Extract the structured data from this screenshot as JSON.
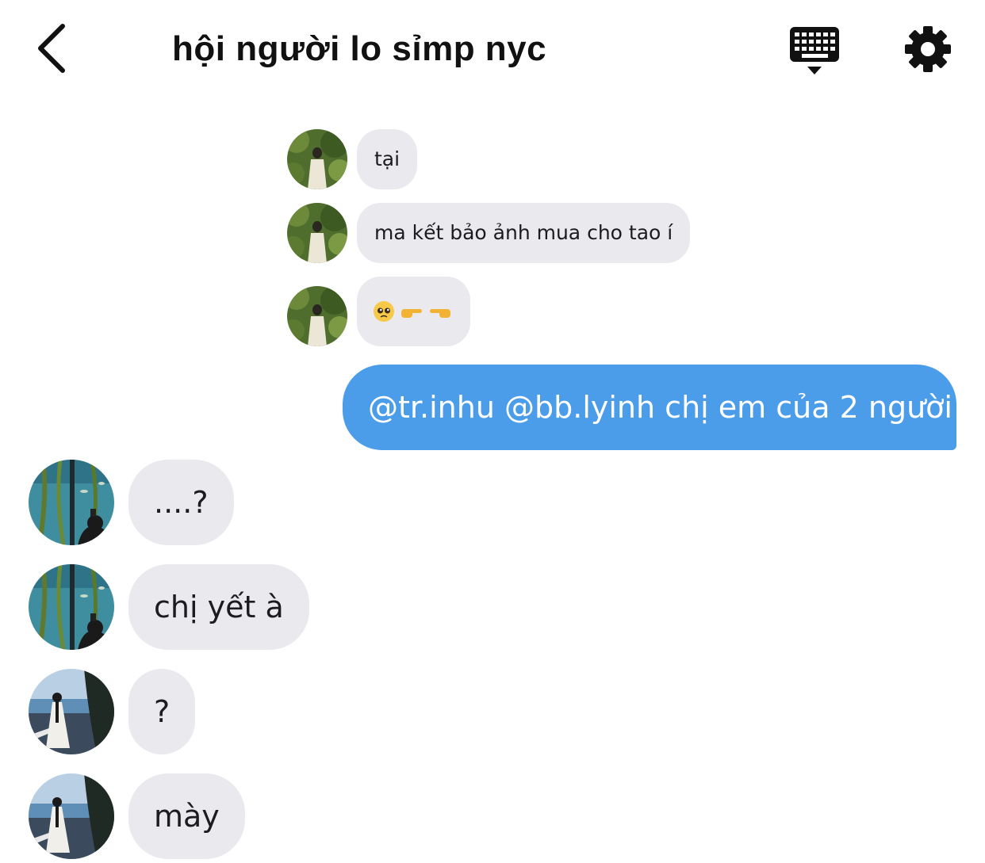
{
  "header": {
    "title": "hội người lo sỉmp nyc",
    "back_icon": "chevron-left-icon",
    "keyboard_icon": "keyboard-icon",
    "settings_icon": "gear-icon"
  },
  "colors": {
    "my_bubble": "#4b9de9",
    "their_bubble": "#e9e9ee",
    "text": "#1c1c1e"
  },
  "messages": [
    {
      "sender": "forest-avatar",
      "text": "tại"
    },
    {
      "sender": "forest-avatar",
      "text": "ma kết bảo ảnh mua cho tao í"
    },
    {
      "sender": "forest-avatar",
      "text": "",
      "emojis": [
        "pleading-face-emoji",
        "point-right-emoji",
        "point-left-emoji"
      ]
    },
    {
      "sender": "me",
      "text": "@tr.inhu @bb.lyinh chị em của 2 người"
    },
    {
      "sender": "aquarium-avatar",
      "text": "....?"
    },
    {
      "sender": "aquarium-avatar",
      "text": "chị yết à"
    },
    {
      "sender": "seaside-avatar",
      "text": "?"
    },
    {
      "sender": "seaside-avatar",
      "text": "mày"
    }
  ]
}
